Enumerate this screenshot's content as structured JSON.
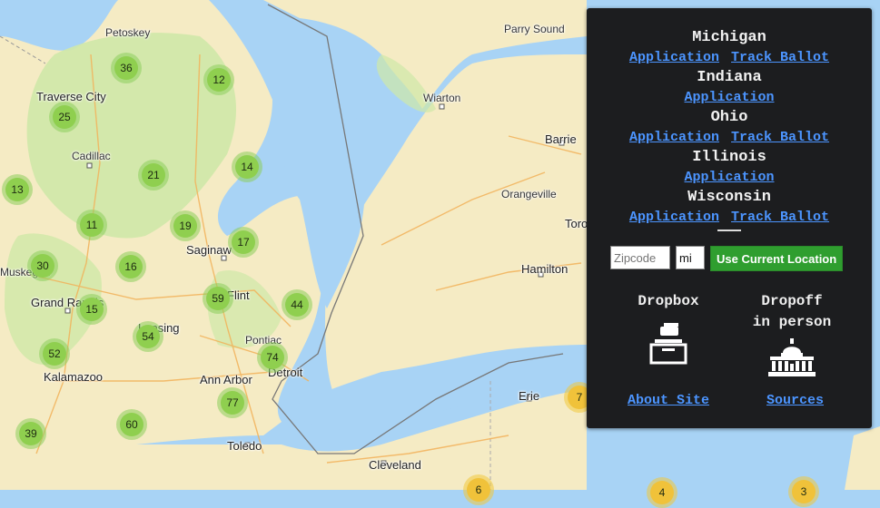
{
  "map": {
    "cities": [
      {
        "name": "Petoskey"
      },
      {
        "name": "Traverse City"
      },
      {
        "name": "Cadillac"
      },
      {
        "name": "Muskegon"
      },
      {
        "name": "Grand Rapids"
      },
      {
        "name": "Saginaw"
      },
      {
        "name": "Flint"
      },
      {
        "name": "Lansing"
      },
      {
        "name": "Pontiac"
      },
      {
        "name": "Kalamazoo"
      },
      {
        "name": "Ann Arbor"
      },
      {
        "name": "Detroit"
      },
      {
        "name": "Toledo"
      },
      {
        "name": "Cleveland"
      },
      {
        "name": "Parry Sound"
      },
      {
        "name": "Wiarton"
      },
      {
        "name": "Barrie"
      },
      {
        "name": "Orangeville"
      },
      {
        "name": "Toronto"
      },
      {
        "name": "Hamilton"
      },
      {
        "name": "Erie"
      }
    ],
    "clusters": [
      "36",
      "12",
      "25",
      "21",
      "14",
      "13",
      "11",
      "19",
      "17",
      "30",
      "16",
      "15",
      "59",
      "44",
      "54",
      "52",
      "74",
      "77",
      "60",
      "39",
      "7",
      "6",
      "4",
      "3"
    ],
    "colors": {
      "water": "#a8d3f5",
      "land": "#f5ebc4",
      "green": "#cfe8a8",
      "cluster_green": "#8fcf4f",
      "cluster_yellow": "#f0c23a",
      "link": "#4c95ff",
      "panel": "#1c1d1f",
      "button": "#2f9e2f"
    }
  },
  "panel": {
    "states": [
      {
        "name": "Michigan",
        "links": [
          "Application",
          "Track Ballot"
        ]
      },
      {
        "name": "Indiana",
        "links": [
          "Application"
        ]
      },
      {
        "name": "Ohio",
        "links": [
          "Application",
          "Track Ballot"
        ]
      },
      {
        "name": "Illinois",
        "links": [
          "Application"
        ]
      },
      {
        "name": "Wisconsin",
        "links": [
          "Application",
          "Track Ballot"
        ]
      }
    ],
    "zip_placeholder": "Zipcode",
    "unit_value": "mi",
    "location_button": "Use Current Location",
    "dropbox_label": "Dropbox",
    "dropoff_label_1": "Dropoff",
    "dropoff_label_2": "in person",
    "dropbox_icon": "ballot-box-icon",
    "dropoff_icon": "capitol-building-icon",
    "about_link": "About Site",
    "sources_link": "Sources"
  }
}
